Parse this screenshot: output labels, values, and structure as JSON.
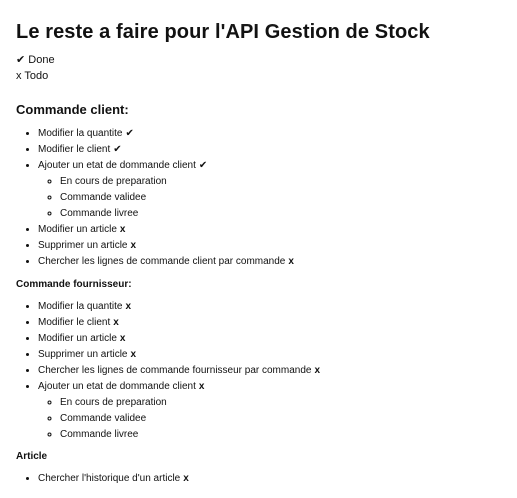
{
  "title": "Le reste a faire pour l'API Gestion de Stock",
  "legend": {
    "done": "✔ Done",
    "todo": "x Todo"
  },
  "sections": {
    "client": {
      "title": "Commande client:",
      "items": [
        {
          "text": "Modifier la quantite",
          "mark": "✔"
        },
        {
          "text": "Modifier le client",
          "mark": "✔"
        },
        {
          "text": "Ajouter un etat de dommande client",
          "mark": "✔"
        },
        {
          "text": "Modifier un article",
          "mark": "x"
        },
        {
          "text": "Supprimer un article",
          "mark": "x"
        },
        {
          "text": "Chercher les lignes de commande client par commande",
          "mark": "x"
        }
      ],
      "substates": [
        "En cours de preparation",
        "Commande validee",
        "Commande livree"
      ]
    },
    "fournisseur": {
      "title": "Commande fournisseur:",
      "items": [
        {
          "text": "Modifier la quantite",
          "mark": "x"
        },
        {
          "text": "Modifier le client",
          "mark": "x"
        },
        {
          "text": "Modifier un article",
          "mark": "x"
        },
        {
          "text": "Supprimer un article",
          "mark": "x"
        },
        {
          "text": "Chercher les lignes de commande fournisseur par commande",
          "mark": "x"
        },
        {
          "text": "Ajouter un etat de dommande client",
          "mark": "x"
        }
      ],
      "substates": [
        "En cours de preparation",
        "Commande validee",
        "Commande livree"
      ]
    },
    "article": {
      "title": "Article",
      "items": [
        {
          "text": "Chercher l'historique d'un article",
          "mark": "x"
        }
      ]
    }
  }
}
